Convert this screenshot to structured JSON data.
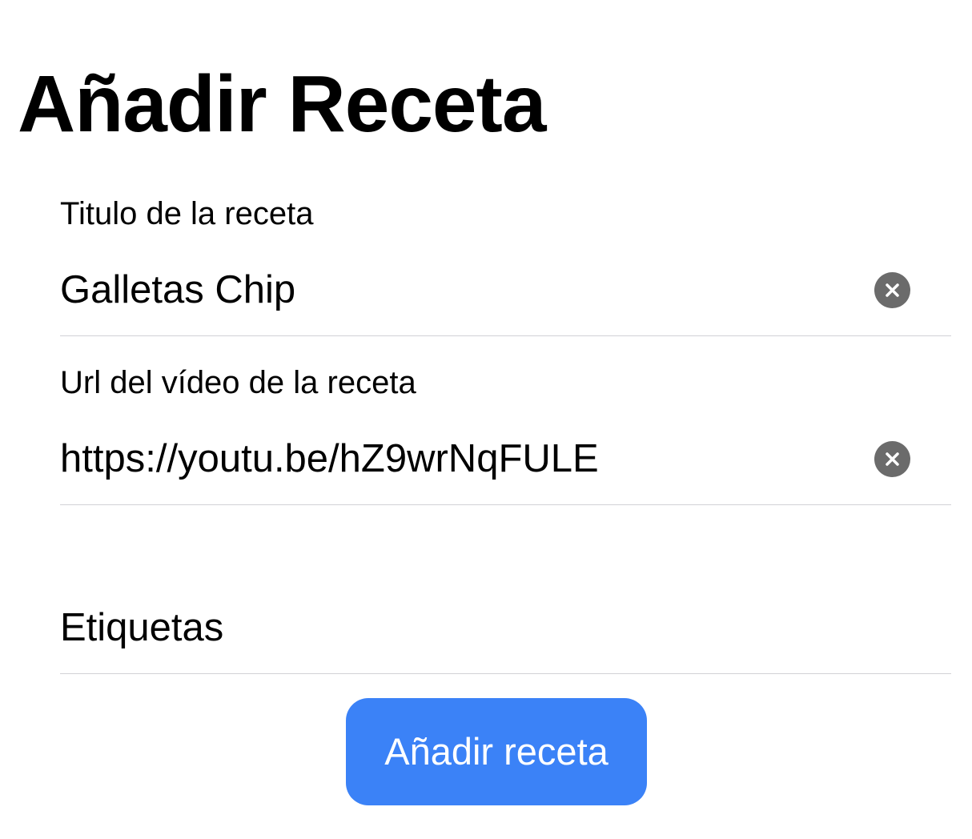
{
  "page": {
    "title": "Añadir Receta"
  },
  "form": {
    "title_field": {
      "label": "Titulo de la receta",
      "value": "Galletas Chip",
      "clear_icon": "clear-circle-x-icon"
    },
    "url_field": {
      "label": "Url del vídeo de la receta",
      "value": "https://youtu.be/hZ9wrNqFULE",
      "clear_icon": "clear-circle-x-icon"
    },
    "tags_field": {
      "placeholder": "Etiquetas",
      "value": ""
    },
    "submit_label": "Añadir receta"
  },
  "colors": {
    "accent": "#3b82f7",
    "clear_icon_bg": "#6b6b6b",
    "separator": "#d1d1d6",
    "text": "#000000",
    "background": "#ffffff"
  }
}
